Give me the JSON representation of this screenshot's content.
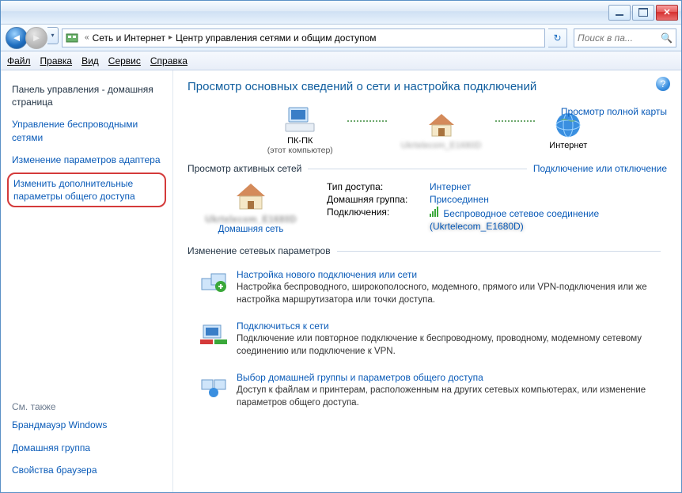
{
  "titlebar": {},
  "breadcrumb": {
    "item1": "Сеть и Интернет",
    "item2": "Центр управления сетями и общим доступом"
  },
  "search": {
    "placeholder": "Поиск в па..."
  },
  "menu": {
    "file": "Файл",
    "edit": "Правка",
    "view": "Вид",
    "service": "Сервис",
    "help": "Справка"
  },
  "sidebar": {
    "home": "Панель управления - домашняя страница",
    "wireless": "Управление беспроводными сетями",
    "adapter": "Изменение параметров адаптера",
    "advanced": "Изменить дополнительные параметры общего доступа",
    "see_also": "См. также",
    "firewall": "Брандмауэр Windows",
    "homegroup": "Домашняя группа",
    "browser": "Свойства браузера"
  },
  "content": {
    "title": "Просмотр основных сведений о сети и настройка подключений",
    "full_map": "Просмотр полной карты",
    "node_pc": "ПК-ПК",
    "node_pc_sub": "(этот компьютер)",
    "node_router": "Ukrtelecom_E1680D",
    "node_internet": "Интернет",
    "active_title": "Просмотр активных сетей",
    "active_link": "Подключение или отключение",
    "net_name": "Ukrtelecom_E1680D",
    "home_net": "Домашняя сеть",
    "access_type_lbl": "Тип доступа:",
    "access_type_val": "Интернет",
    "homegroup_lbl": "Домашняя группа:",
    "homegroup_val": "Присоединен",
    "connections_lbl": "Подключения:",
    "connections_val": "Беспроводное сетевое соединение",
    "conn_sub": "(Ukrtelecom_E1680D)",
    "settings_title": "Изменение сетевых параметров",
    "opt1_title": "Настройка нового подключения или сети",
    "opt1_desc": "Настройка беспроводного, широкополосного, модемного, прямого или VPN-подключения или же настройка маршрутизатора или точки доступа.",
    "opt2_title": "Подключиться к сети",
    "opt2_desc": "Подключение или повторное подключение к беспроводному, проводному, модемному сетевому соединению или подключение к VPN.",
    "opt3_title": "Выбор домашней группы и параметров общего доступа",
    "opt3_desc": "Доступ к файлам и принтерам, расположенным на других сетевых компьютерах, или изменение параметров общего доступа."
  }
}
